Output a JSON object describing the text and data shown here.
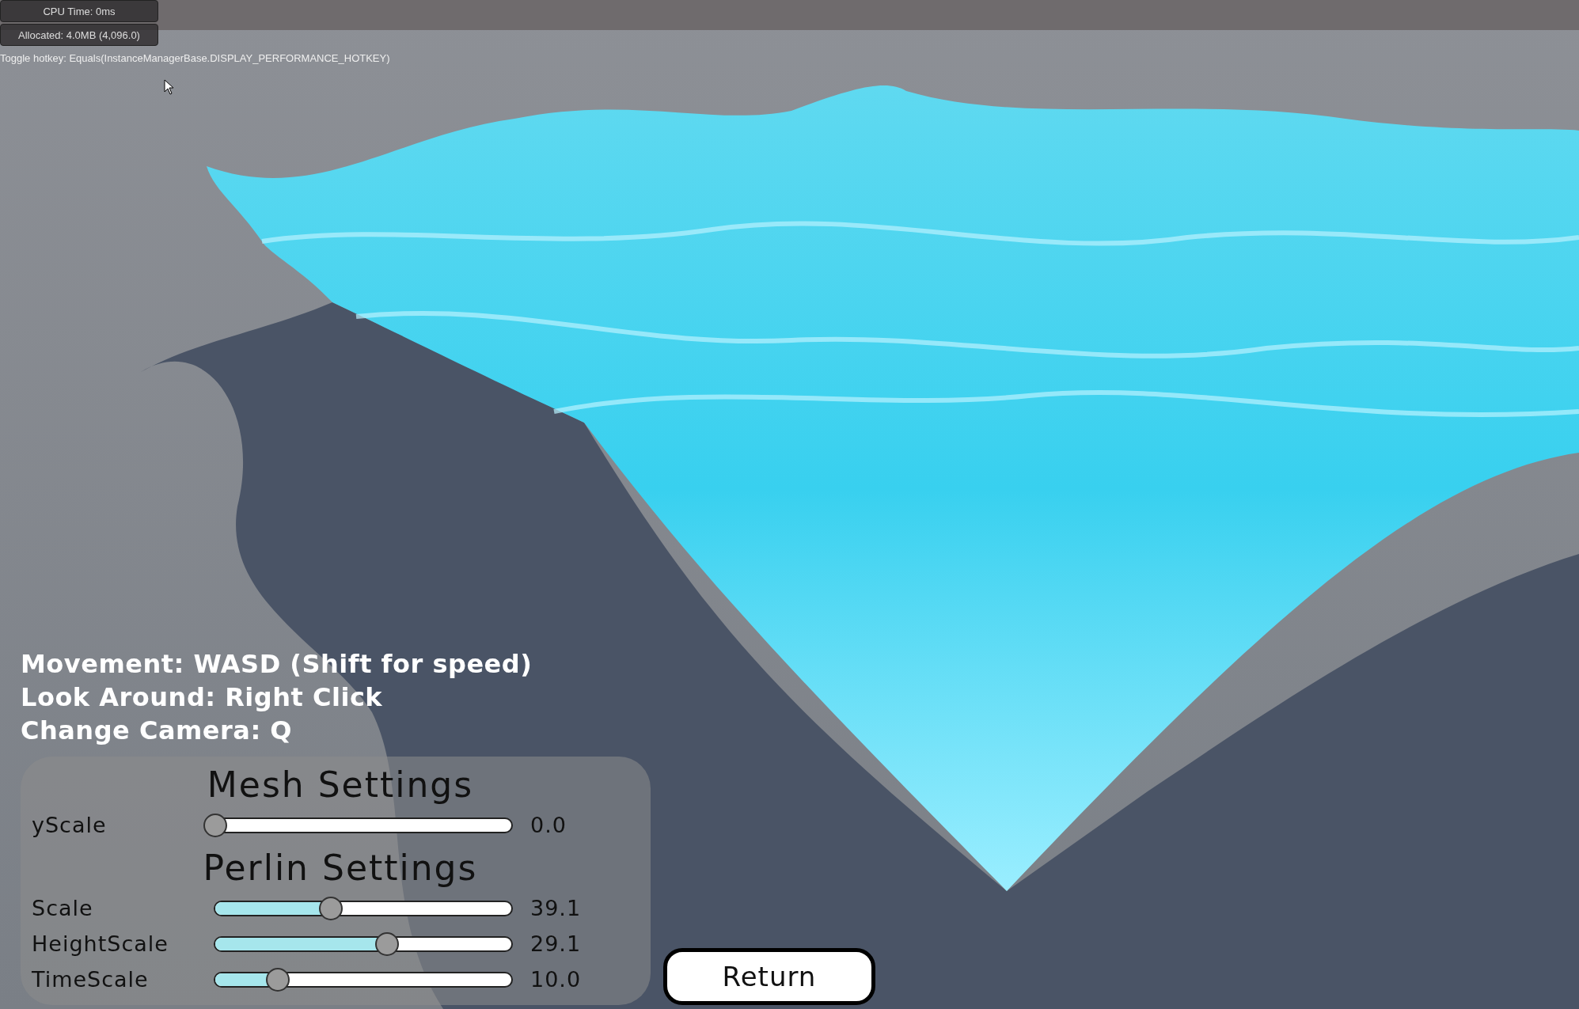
{
  "performance": {
    "cpu_time": "CPU Time: 0ms",
    "allocated": "Allocated: 4.0MB (4,096.0)",
    "toggle_hotkey": "Toggle hotkey: Equals(InstanceManagerBase.DISPLAY_PERFORMANCE_HOTKEY)"
  },
  "instructions": [
    "Movement: WASD (Shift for speed)",
    "Look Around: Right Click",
    "Change Camera: Q"
  ],
  "settings_panel": {
    "sections": [
      {
        "title": "Mesh Settings",
        "sliders": [
          {
            "label": "yScale",
            "level": 0,
            "reading": "0.0"
          }
        ]
      },
      {
        "title": "Perlin Settings",
        "sliders": [
          {
            "label": "Scale",
            "level": 0.39,
            "reading": "39.1"
          },
          {
            "label": "HeightScale",
            "level": 0.58,
            "reading": "29.1"
          },
          {
            "label": "TimeScale",
            "level": 0.21,
            "reading": "10.0"
          }
        ]
      }
    ]
  },
  "return_button": {
    "label": "Return"
  }
}
